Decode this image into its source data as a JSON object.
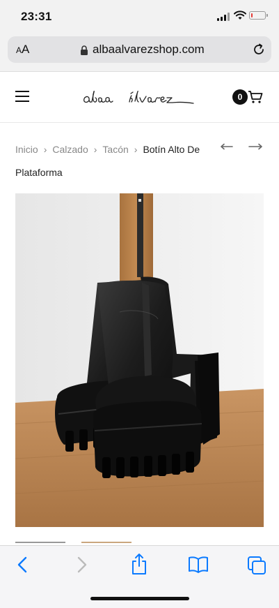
{
  "status_bar": {
    "time": "23:31",
    "battery_level": 0.15,
    "battery_color": "#e53935"
  },
  "browser": {
    "text_size_button": "AA",
    "url": "albaalvarezshop.com"
  },
  "header": {
    "logo_text": "alba álvarez",
    "cart_count": "0"
  },
  "breadcrumb": {
    "items": [
      "Inicio",
      "Calzado",
      "Tacón"
    ],
    "separator": "›",
    "current_line1": "Botín Alto De",
    "current_line2": "Plataforma"
  },
  "product": {
    "image_alt": "Botín alto de plataforma negro"
  },
  "toolbar": {
    "icons": [
      "back-arrow-icon",
      "forward-arrow-icon",
      "share-icon",
      "bookmarks-icon",
      "tabs-icon"
    ],
    "accent": "#0a7aff"
  }
}
